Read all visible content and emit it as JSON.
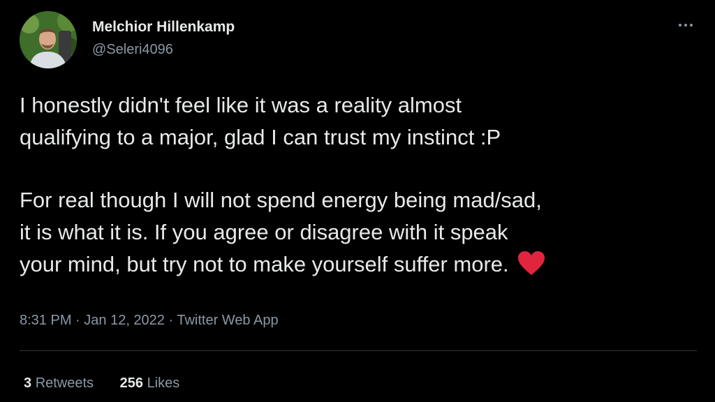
{
  "author": {
    "display_name": "Melchior Hillenkamp",
    "handle": "@Seleri4096",
    "avatar_icon": "profile-photo"
  },
  "tweet": {
    "paragraph1": [
      "I honestly didn't feel like it was a reality almost",
      "qualifying to a major, glad I can trust my instinct :P"
    ],
    "paragraph2": [
      "For real though I will not spend energy being mad/sad,",
      "it is what it is. If you agree or disagree with it speak",
      "your mind, but try not to make yourself suffer more."
    ],
    "emoji": "heart-icon"
  },
  "meta": {
    "time": "8:31 PM",
    "separator": " · ",
    "date": "Jan 12, 2022",
    "source": "Twitter Web App"
  },
  "stats": {
    "retweets_count": "3",
    "retweets_label": "Retweets",
    "likes_count": "256",
    "likes_label": "Likes"
  },
  "colors": {
    "background": "#000000",
    "text": "#e7e9ea",
    "secondary_text": "#8b98a5",
    "divider": "#2f3336",
    "heart": "#e0263f"
  }
}
